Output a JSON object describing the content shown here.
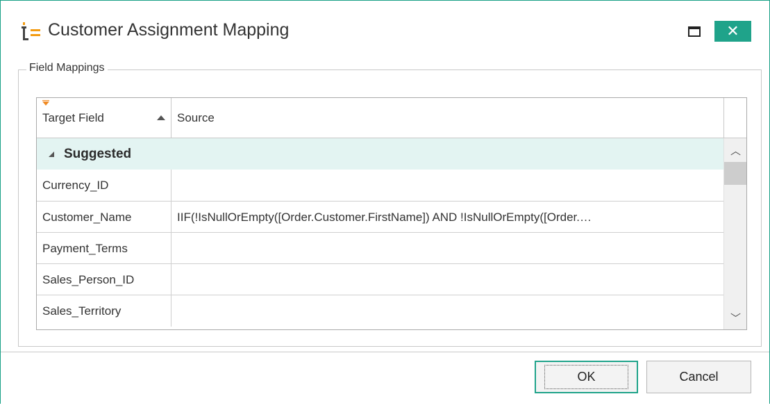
{
  "window": {
    "title": "Customer Assignment Mapping",
    "accent_color": "#1fa38a",
    "icons": {
      "app": "tableau-logo-icon",
      "maximize": "maximize-icon",
      "close": "close-icon"
    },
    "close_glyph": "✕"
  },
  "group": {
    "legend": "Field Mappings"
  },
  "grid": {
    "columns": [
      {
        "label": "Target Field",
        "sorted": "ascending"
      },
      {
        "label": "Source"
      }
    ],
    "group_label": "Suggested",
    "rows": [
      {
        "target": "Currency_ID",
        "source": ""
      },
      {
        "target": "Customer_Name",
        "source": "IIF(!IsNullOrEmpty([Order.Customer.FirstName]) AND !IsNullOrEmpty([Order.…"
      },
      {
        "target": "Payment_Terms",
        "source": ""
      },
      {
        "target": "Sales_Person_ID",
        "source": ""
      },
      {
        "target": "Sales_Territory",
        "source": ""
      }
    ],
    "scroll_up_glyph": "︿",
    "scroll_down_glyph": "﹀"
  },
  "buttons": {
    "ok": "OK",
    "cancel": "Cancel"
  }
}
